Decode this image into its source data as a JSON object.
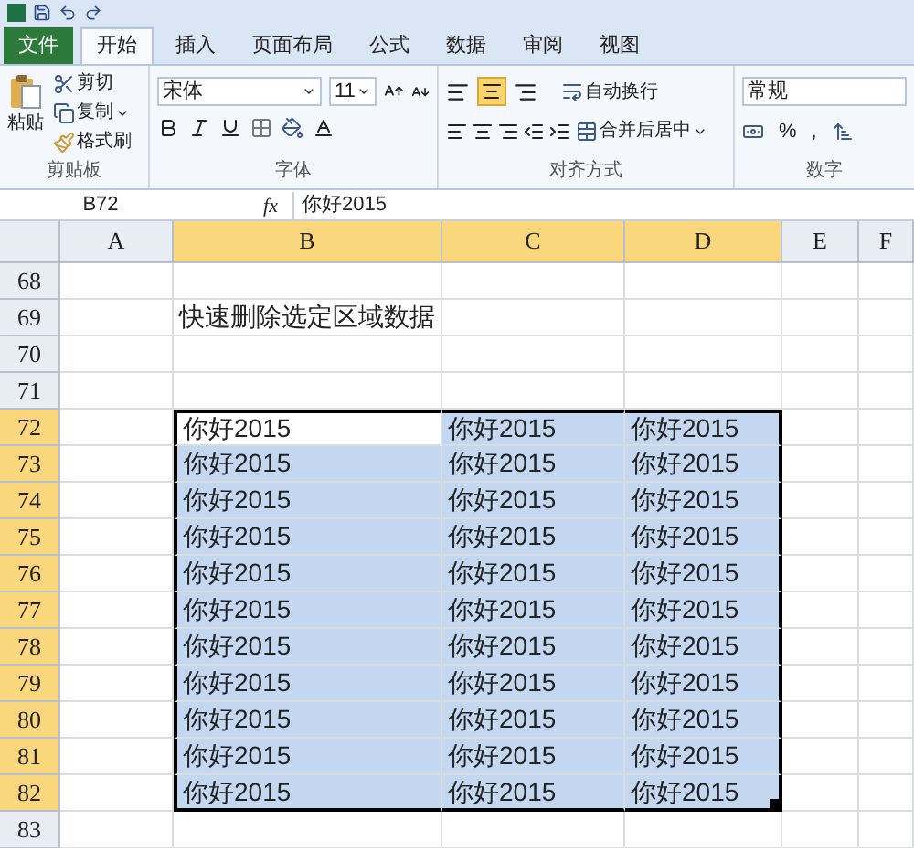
{
  "tabs": [
    {
      "label": "文件",
      "kind": "file",
      "selected": false
    },
    {
      "label": "开始",
      "kind": "tab",
      "selected": true
    },
    {
      "label": "插入",
      "kind": "tab",
      "selected": false
    },
    {
      "label": "页面布局",
      "kind": "tab",
      "selected": false
    },
    {
      "label": "公式",
      "kind": "tab",
      "selected": false
    },
    {
      "label": "数据",
      "kind": "tab",
      "selected": false
    },
    {
      "label": "审阅",
      "kind": "tab",
      "selected": false
    },
    {
      "label": "视图",
      "kind": "tab",
      "selected": false
    }
  ],
  "clipboard": {
    "paste": "粘贴",
    "cut": "剪切",
    "copy": "复制",
    "format_painter": "格式刷",
    "label": "剪贴板"
  },
  "font": {
    "name": "宋体",
    "size": "11",
    "label": "字体"
  },
  "alignment": {
    "middle_align_selected": true,
    "wrap": "自动换行",
    "merge": "合并后居中",
    "label": "对齐方式"
  },
  "number": {
    "format": "常规",
    "percent": "%",
    "comma": ",",
    "label": "数字"
  },
  "formula_bar": {
    "name_box": "B72",
    "fx": "fx",
    "value": "你好2015"
  },
  "columns": [
    {
      "label": "A",
      "selected": false
    },
    {
      "label": "B",
      "selected": true
    },
    {
      "label": "C",
      "selected": true
    },
    {
      "label": "D",
      "selected": true
    },
    {
      "label": "E",
      "selected": false
    },
    {
      "label": "F",
      "selected": false
    }
  ],
  "rows": [
    {
      "header": "68",
      "selected": false,
      "active": false
    },
    {
      "header": "69",
      "selected": false,
      "active": false,
      "b": "快速删除选定区域数据"
    },
    {
      "header": "70",
      "selected": false,
      "active": false
    },
    {
      "header": "71",
      "selected": false,
      "active": false
    },
    {
      "header": "72",
      "selected": true,
      "active": true,
      "b": "你好2015",
      "c": "你好2015",
      "d": "你好2015"
    },
    {
      "header": "73",
      "selected": true,
      "active": false,
      "b": "你好2015",
      "c": "你好2015",
      "d": "你好2015"
    },
    {
      "header": "74",
      "selected": true,
      "active": false,
      "b": "你好2015",
      "c": "你好2015",
      "d": "你好2015"
    },
    {
      "header": "75",
      "selected": true,
      "active": false,
      "b": "你好2015",
      "c": "你好2015",
      "d": "你好2015"
    },
    {
      "header": "76",
      "selected": true,
      "active": false,
      "b": "你好2015",
      "c": "你好2015",
      "d": "你好2015"
    },
    {
      "header": "77",
      "selected": true,
      "active": false,
      "b": "你好2015",
      "c": "你好2015",
      "d": "你好2015"
    },
    {
      "header": "78",
      "selected": true,
      "active": false,
      "b": "你好2015",
      "c": "你好2015",
      "d": "你好2015"
    },
    {
      "header": "79",
      "selected": true,
      "active": false,
      "b": "你好2015",
      "c": "你好2015",
      "d": "你好2015"
    },
    {
      "header": "80",
      "selected": true,
      "active": false,
      "b": "你好2015",
      "c": "你好2015",
      "d": "你好2015"
    },
    {
      "header": "81",
      "selected": true,
      "active": false,
      "b": "你好2015",
      "c": "你好2015",
      "d": "你好2015"
    },
    {
      "header": "82",
      "selected": true,
      "active": false,
      "b": "你好2015",
      "c": "你好2015",
      "d": "你好2015"
    },
    {
      "header": "83",
      "selected": false,
      "active": false
    }
  ]
}
